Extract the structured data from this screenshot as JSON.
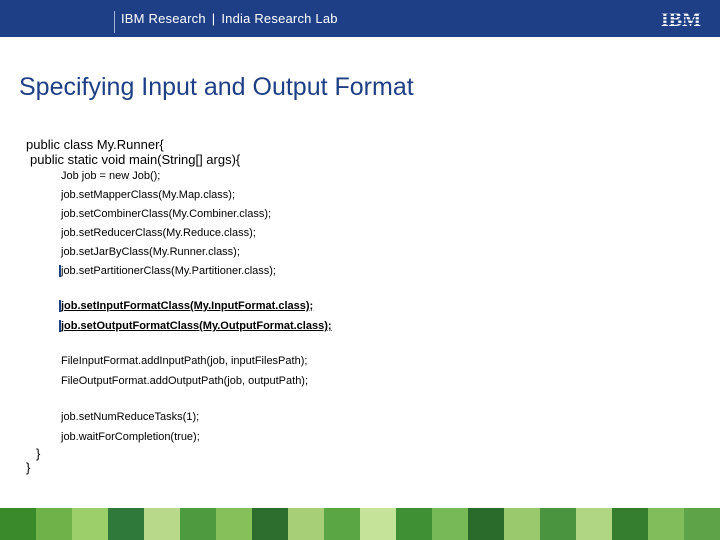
{
  "header": {
    "org": "IBM Research",
    "separator": "|",
    "lab": "India Research Lab",
    "logo_text": "IBM"
  },
  "slide": {
    "title": "Specifying Input and Output Format"
  },
  "code": {
    "class_decl": "public class My.Runner{",
    "method_decl": "public static void main(String[] args){",
    "group1": [
      "Job job = new Job();",
      "job.setMapperClass(My.Map.class);",
      "job.setCombinerClass(My.Combiner.class);",
      "job.setReducerClass(My.Reduce.class);",
      "job.setJarByClass(My.Runner.class);",
      "job.setPartitionerClass(My.Partitioner.class);"
    ],
    "group2": [
      "job.setInputFormatClass(My.InputFormat.class);",
      "job.setOutputFormatClass(My.OutputFormat.class);"
    ],
    "group3": [
      "FileInputFormat.addInputPath(job, inputFilesPath);",
      "FileOutputFormat.addOutputPath(job, outputPath);"
    ],
    "group4": [
      "job.setNumReduceTasks(1);",
      "job.waitForCompletion(true);"
    ],
    "close_method": "}",
    "close_class": "}"
  },
  "colors": {
    "header_bg": "#1e3f86",
    "title": "#1e3f86",
    "footer_tiles": [
      "#3a8a2c",
      "#6fb24a",
      "#9ccf6a",
      "#2f7a3a",
      "#b8d98a",
      "#4e9a3e",
      "#86c05a",
      "#2d6e2e",
      "#a7cf78",
      "#5aa544",
      "#c6e39a",
      "#3f8f35",
      "#77b957",
      "#2a6a2a",
      "#99c96c",
      "#4a9440",
      "#b0d684",
      "#357e30",
      "#82bd5c",
      "#5fa348"
    ]
  }
}
